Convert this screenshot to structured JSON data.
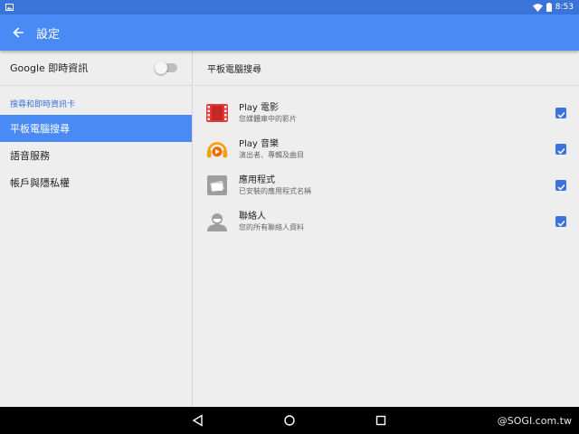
{
  "status_bar": {
    "time": "8:53"
  },
  "app_bar": {
    "title": "設定"
  },
  "left_pane": {
    "toggle": {
      "label": "Google 即時資訊",
      "enabled": false
    },
    "section_header": "搜尋和即時資訊卡",
    "items": [
      {
        "label": "平板電腦搜尋",
        "active": true
      },
      {
        "label": "語音服務",
        "active": false
      },
      {
        "label": "帳戶與隱私權",
        "active": false
      }
    ]
  },
  "right_pane": {
    "header": "平板電腦搜尋",
    "items": [
      {
        "title": "Play 電影",
        "subtitle": "您媒體庫中的影片",
        "icon": "play-movies-icon",
        "checked": true
      },
      {
        "title": "Play 音樂",
        "subtitle": "演出者、專輯及曲目",
        "icon": "play-music-icon",
        "checked": true
      },
      {
        "title": "應用程式",
        "subtitle": "已安裝的應用程式名稱",
        "icon": "apps-icon",
        "checked": true
      },
      {
        "title": "聯絡人",
        "subtitle": "您的所有聯絡人資料",
        "icon": "contacts-icon",
        "checked": true
      }
    ]
  },
  "watermark": "@SOGI.com.tw",
  "colors": {
    "accent": "#4a8af4",
    "status_bar": "#3a74d8",
    "checkbox": "#3a74d8",
    "movies_red": "#e53935",
    "music_orange": "#f5a00c"
  }
}
